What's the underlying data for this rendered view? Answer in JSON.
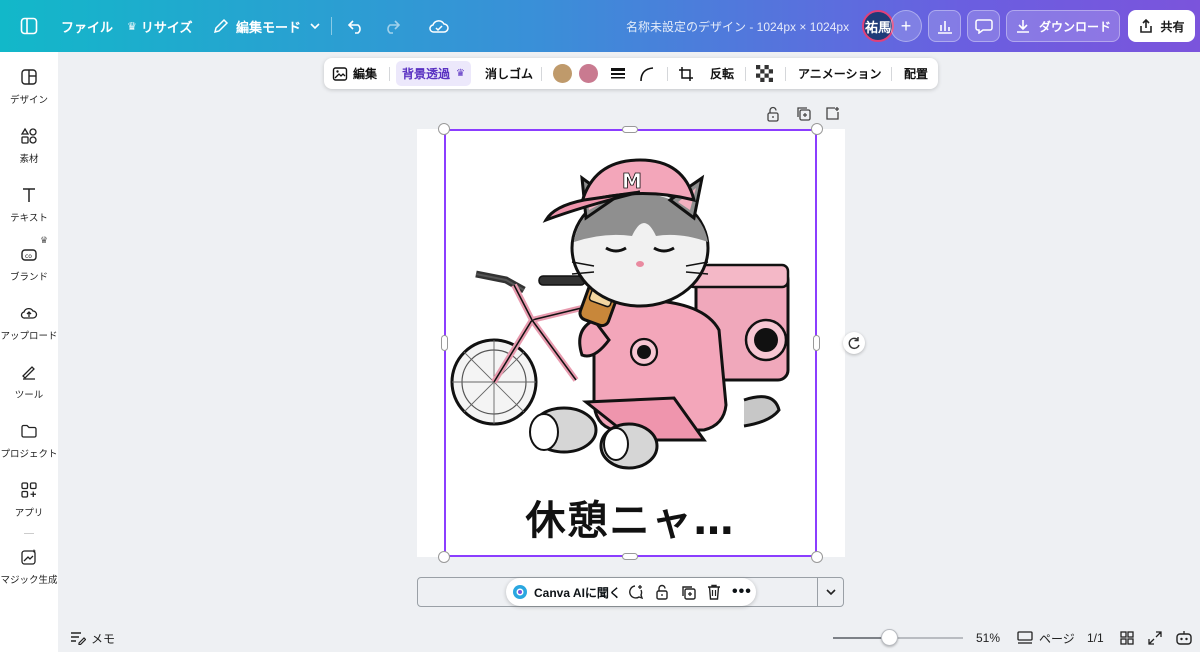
{
  "topbar": {
    "file_label": "ファイル",
    "resize_label": "リサイズ",
    "edit_mode_label": "編集モード",
    "doc_title": "名称未設定のデザイン - 1024px × 1024px",
    "avatar_text": "祐馬",
    "download_label": "ダウンロード",
    "share_label": "共有"
  },
  "sidebar": {
    "items": [
      {
        "label": "デザイン",
        "icon": "design-icon"
      },
      {
        "label": "素材",
        "icon": "elements-icon"
      },
      {
        "label": "テキスト",
        "icon": "text-icon"
      },
      {
        "label": "ブランド",
        "icon": "brand-icon"
      },
      {
        "label": "アップロード",
        "icon": "upload-icon"
      },
      {
        "label": "ツール",
        "icon": "tools-icon"
      },
      {
        "label": "プロジェクト",
        "icon": "folder-icon"
      },
      {
        "label": "アプリ",
        "icon": "apps-icon"
      },
      {
        "label": "マジック生成",
        "icon": "magic-icon"
      }
    ]
  },
  "toolbar": {
    "edit_label": "編集",
    "bg_remove_label": "背景透過",
    "eraser_label": "消しゴム",
    "color1": "#bf9a6b",
    "color2": "#c97a90",
    "flip_label": "反転",
    "animation_label": "アニメーション",
    "position_label": "配置"
  },
  "canvas": {
    "caption": "休憩ニャ…"
  },
  "ai_bar": {
    "ask_label": "Canva AIに聞く"
  },
  "bottom": {
    "notes_label": "メモ",
    "zoom_value": "51%",
    "zoom_fraction": 0.43,
    "pages_label": "ページ",
    "page_count": "1/1"
  },
  "colors": {
    "accent": "#8b3dff",
    "topbar_start": "#12b8c9",
    "topbar_end": "#7b54dc"
  }
}
